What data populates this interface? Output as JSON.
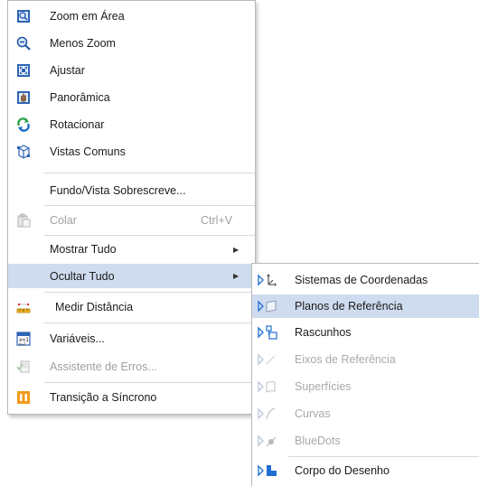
{
  "main_menu": {
    "items": [
      {
        "label": "Zoom em Área",
        "icon": "zoom-area-icon"
      },
      {
        "label": "Menos Zoom",
        "icon": "zoom-out-icon"
      },
      {
        "label": "Ajustar",
        "icon": "fit-icon"
      },
      {
        "label": "Panorâmica",
        "icon": "pan-icon"
      },
      {
        "label": "Rotacionar",
        "icon": "rotate-icon"
      },
      {
        "label": "Vistas Comuns",
        "icon": "common-views-icon"
      },
      {
        "label": "Fundo/Vista Sobrescreve..."
      },
      {
        "label": "Colar",
        "shortcut": "Ctrl+V",
        "icon": "paste-icon",
        "disabled": true
      },
      {
        "label": "Mostrar Tudo"
      },
      {
        "label": "Ocultar Tudo"
      },
      {
        "label": "Medir Distância",
        "icon": "measure-distance-icon"
      },
      {
        "label": "Variáveis...",
        "icon": "variables-icon"
      },
      {
        "label": "Assistente de Erros...",
        "icon": "error-assistant-icon",
        "disabled": true
      },
      {
        "label": "Transição a Síncrono",
        "icon": "sync-transition-icon"
      }
    ]
  },
  "sub_menu": {
    "items": [
      {
        "label": "Sistemas de Coordenadas",
        "icon": "coordinate-systems-icon"
      },
      {
        "label": "Planos de Referência",
        "icon": "reference-planes-icon"
      },
      {
        "label": "Rascunhos",
        "icon": "sketches-icon"
      },
      {
        "label": "Eixos de Referência",
        "icon": "reference-axes-icon",
        "disabled": true
      },
      {
        "label": "Superfícies",
        "icon": "surfaces-icon",
        "disabled": true
      },
      {
        "label": "Curvas",
        "icon": "curves-icon",
        "disabled": true
      },
      {
        "label": "BlueDots",
        "icon": "bluedots-icon",
        "disabled": true
      },
      {
        "label": "Corpo do Desenho",
        "icon": "design-body-icon"
      }
    ]
  },
  "colors": {
    "hover": "#cfdcef",
    "accent": "#1e6fd0",
    "disabled": "#a0a0a0"
  }
}
